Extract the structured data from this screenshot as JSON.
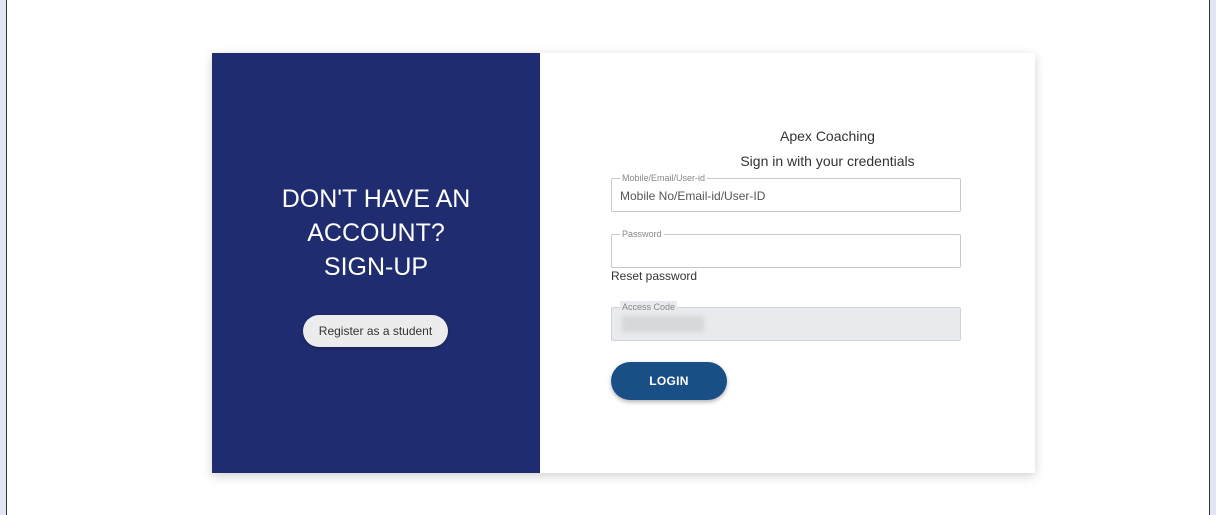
{
  "left_panel": {
    "heading_lines": [
      "DON'T HAVE AN",
      "ACCOUNT?",
      "SIGN-UP"
    ],
    "register_label": "Register as a student"
  },
  "right_panel": {
    "org_name": "Apex Coaching",
    "subtitle": "Sign in with your credentials",
    "user_field": {
      "legend": "Mobile/Email/User-id",
      "placeholder": "Mobile No/Email-id/User-ID",
      "value": ""
    },
    "password_field": {
      "legend": "Password",
      "value": ""
    },
    "reset_label": "Reset password",
    "access_field": {
      "legend": "Access Code"
    },
    "login_label": "LOGIN"
  },
  "colors": {
    "left_panel_bg": "#1f2d70",
    "login_button_bg": "#1a4f86",
    "page_bg": "#dfe7f3"
  }
}
